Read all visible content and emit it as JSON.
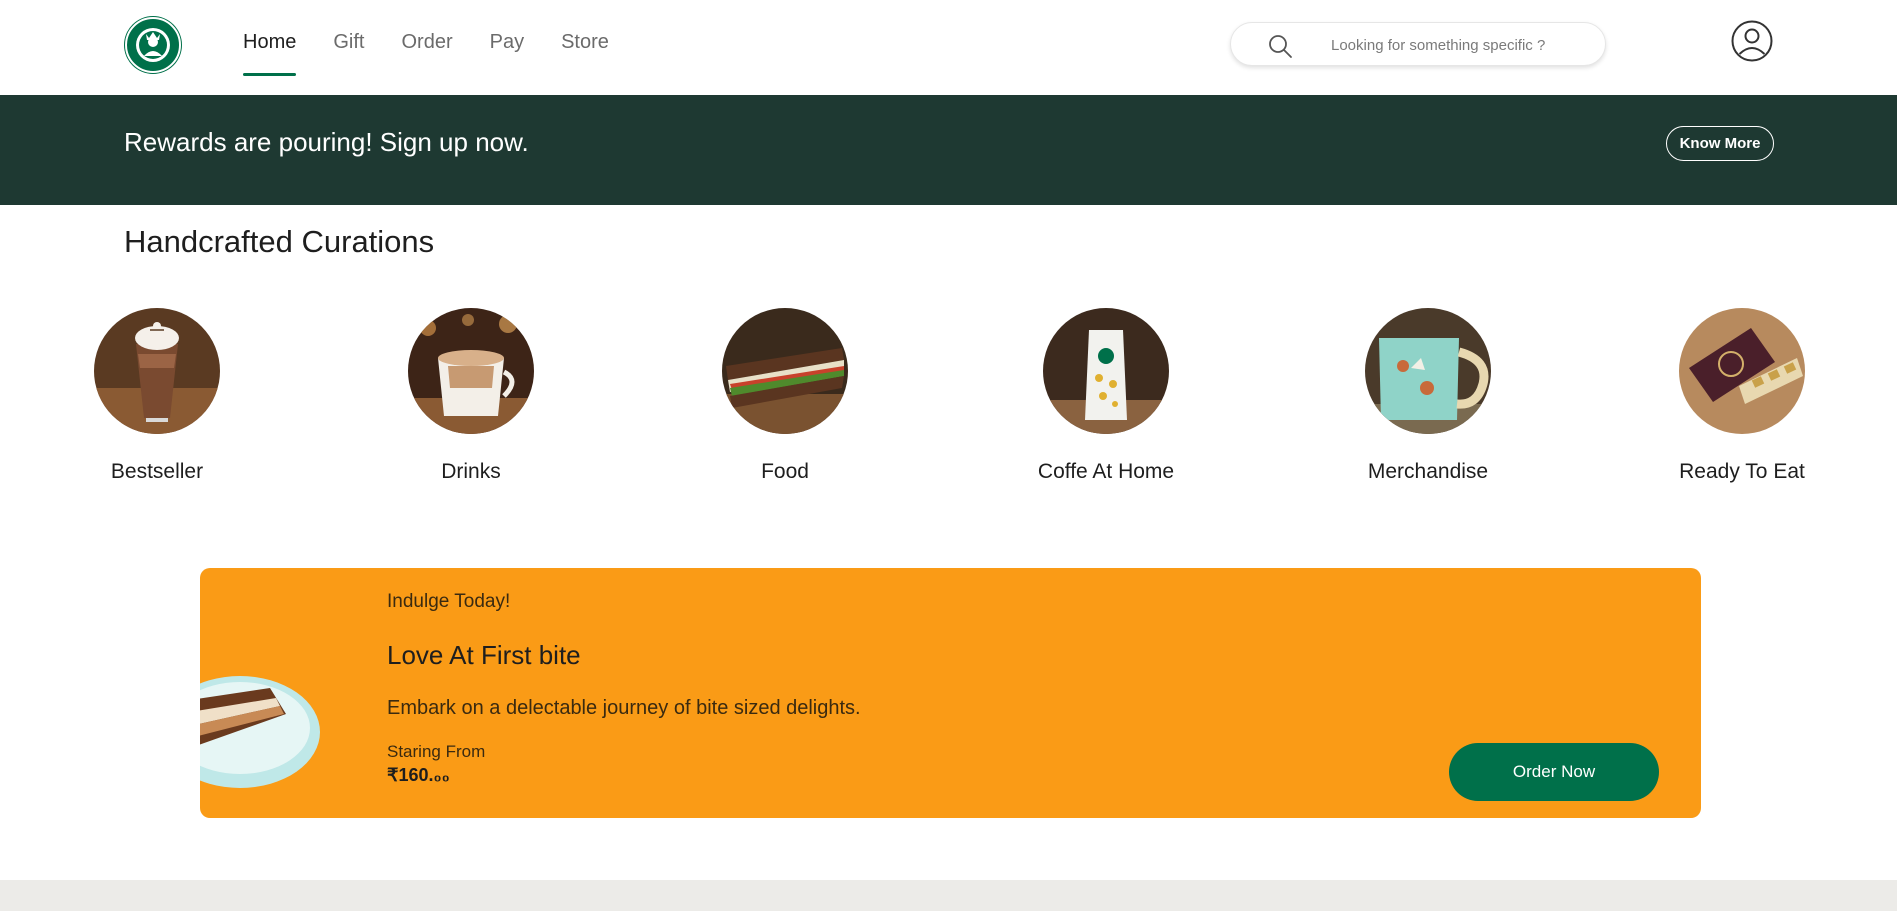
{
  "header": {
    "logo": "starbucks-siren-logo",
    "nav": [
      {
        "label": "Home",
        "active": true
      },
      {
        "label": "Gift",
        "active": false
      },
      {
        "label": "Order",
        "active": false
      },
      {
        "label": "Pay",
        "active": false
      },
      {
        "label": "Store",
        "active": false
      }
    ],
    "search": {
      "placeholder": "Looking for something specific ?",
      "icon": "search-icon"
    },
    "account_icon": "user-icon"
  },
  "rewards_banner": {
    "text": "Rewards are pouring! Sign up now.",
    "button_label": "Know More"
  },
  "curations": {
    "title": "Handcrafted Curations",
    "items": [
      {
        "label": "Bestseller"
      },
      {
        "label": "Drinks"
      },
      {
        "label": "Food"
      },
      {
        "label": "Coffe At Home"
      },
      {
        "label": "Merchandise"
      },
      {
        "label": "Ready To Eat"
      }
    ]
  },
  "promo": {
    "eyebrow": "Indulge Today!",
    "title": "Love At First bite",
    "description": "Embark on a delectable journey of bite sized delights.",
    "from_label": "Staring From",
    "price": "₹160.₀₀",
    "button_label": "Order Now"
  },
  "colors": {
    "brand_green": "#00704a",
    "banner_green": "#1e3932",
    "promo_orange": "#fa9b16"
  }
}
